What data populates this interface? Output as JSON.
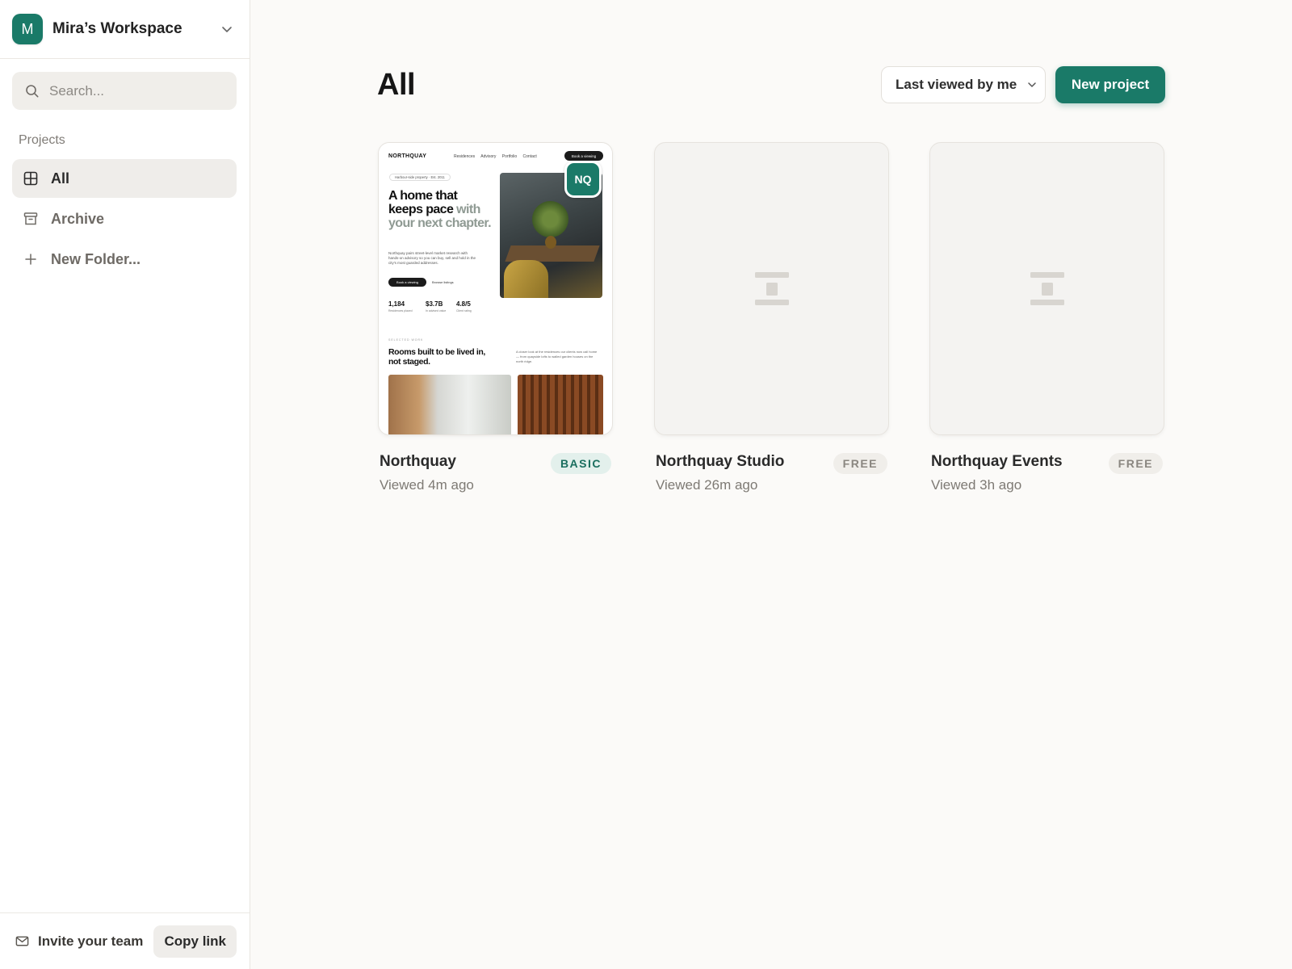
{
  "workspace": {
    "initial": "M",
    "name": "Mira’s Workspace"
  },
  "search": {
    "placeholder": "Search..."
  },
  "sidebar": {
    "section_label": "Projects",
    "items": [
      {
        "label": "All",
        "icon": "grid-icon",
        "active": true
      },
      {
        "label": "Archive",
        "icon": "archive-icon",
        "active": false
      },
      {
        "label": "New Folder...",
        "icon": "plus-icon",
        "active": false
      }
    ],
    "footer": {
      "invite_label": "Invite your team",
      "copy_label": "Copy link"
    }
  },
  "header": {
    "title": "All",
    "sort_label": "Last viewed by me",
    "new_project_label": "New project"
  },
  "projects": [
    {
      "name": "Northquay",
      "viewed": "Viewed 4m ago",
      "plan": "BASIC",
      "preview": {
        "logo": "NORTHQUAY",
        "nav": "Residences Advisory Portfolio Contact",
        "cta": "Book a viewing",
        "pill": "Harbour-side property · Est. 2011",
        "headline_a": "A home that keeps pace",
        "headline_b": "with your next chapter.",
        "body": "Northquay pairs street-level market research with hands-on advisory so you can buy, sell and hold in the city's most guarded addresses.",
        "btn_primary": "Book a viewing",
        "btn_secondary": "Browse listings",
        "stats": [
          {
            "value": "1,184",
            "label": "Residences placed"
          },
          {
            "value": "$3.7B",
            "label": "In advised value"
          },
          {
            "value": "4.8/5",
            "label": "Client rating"
          }
        ],
        "avatar": "NQ",
        "kicker": "SELECTED WORK",
        "section_title": "Rooms built to be lived in, not staged.",
        "section_body": "A closer look at the residences our clients now call home — from quayside lofts to walled garden houses on the north ridge."
      }
    },
    {
      "name": "Northquay Studio",
      "viewed": "Viewed 26m ago",
      "plan": "FREE"
    },
    {
      "name": "Northquay Events",
      "viewed": "Viewed 3h ago",
      "plan": "FREE"
    }
  ],
  "colors": {
    "accent": "#1a7a68",
    "basic_badge_bg": "#e3f0ec",
    "free_badge_bg": "#f0eeea"
  }
}
